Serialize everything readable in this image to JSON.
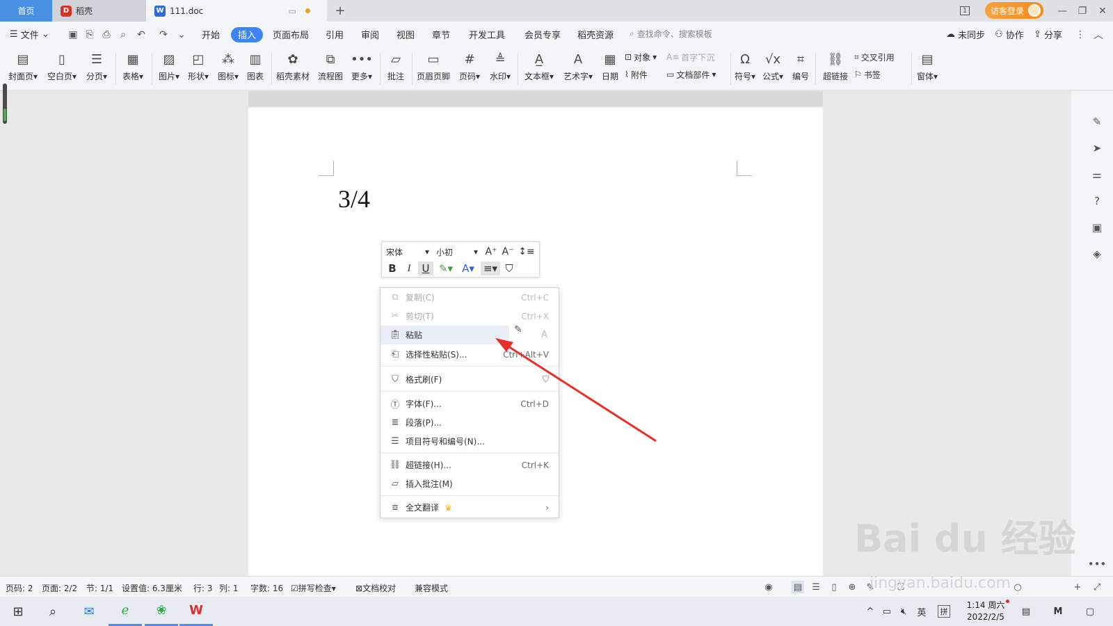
{
  "tabs": {
    "home": "首页",
    "daoke": "稻壳",
    "doc": "111.doc",
    "add": "+"
  },
  "titlebar": {
    "visitor_login": "访客登录",
    "page_badge": "1"
  },
  "menu": {
    "file": "文件",
    "items": [
      "开始",
      "插入",
      "页面布局",
      "引用",
      "审阅",
      "视图",
      "章节",
      "开发工具",
      "会员专享",
      "稻壳资源"
    ],
    "active": "插入",
    "search_placeholder": "查找命令、搜索模板",
    "not_synced": "未同步",
    "collaborate": "协作",
    "share": "分享"
  },
  "ribbon": {
    "buttons": [
      {
        "label": "封面页",
        "icon": "cover-page-icon"
      },
      {
        "label": "空白页",
        "icon": "blank-page-icon"
      },
      {
        "label": "分页",
        "icon": "page-break-icon"
      },
      {
        "label": "表格",
        "icon": "table-icon"
      },
      {
        "label": "图片",
        "icon": "picture-icon"
      },
      {
        "label": "形状",
        "icon": "shape-icon"
      },
      {
        "label": "图标",
        "icon": "icons-icon"
      },
      {
        "label": "图表",
        "icon": "chart-icon"
      },
      {
        "label": "稻壳素材",
        "icon": "material-icon"
      },
      {
        "label": "流程图",
        "icon": "flowchart-icon"
      },
      {
        "label": "更多",
        "icon": "more-icon"
      },
      {
        "label": "批注",
        "icon": "comment-icon"
      },
      {
        "label": "页眉页脚",
        "icon": "header-footer-icon"
      },
      {
        "label": "页码",
        "icon": "page-number-icon"
      },
      {
        "label": "水印",
        "icon": "watermark-icon"
      },
      {
        "label": "文本框",
        "icon": "textbox-icon"
      },
      {
        "label": "艺术字",
        "icon": "wordart-icon"
      },
      {
        "label": "日期",
        "icon": "date-icon"
      },
      {
        "label": "符号",
        "icon": "symbol-icon"
      },
      {
        "label": "公式",
        "icon": "formula-icon"
      },
      {
        "label": "编号",
        "icon": "numbering-icon"
      },
      {
        "label": "超链接",
        "icon": "hyperlink-icon"
      },
      {
        "label": "窗体",
        "icon": "form-icon"
      }
    ],
    "small": {
      "object": "对象",
      "dropcap": "首字下沉",
      "attachment": "附件",
      "doc_parts": "文档部件",
      "cross_ref": "交叉引用",
      "bookmark": "书签"
    }
  },
  "document": {
    "text": "3/4"
  },
  "mini_toolbar": {
    "font": "宋体",
    "size": "小初",
    "bold": "B",
    "italic": "I",
    "underline": "U"
  },
  "context_menu": {
    "items": [
      {
        "label": "复制(C)",
        "shortcut": "Ctrl+C",
        "disabled": true
      },
      {
        "label": "剪切(T)",
        "shortcut": "Ctrl+X",
        "disabled": true
      },
      {
        "label": "粘贴",
        "shortcut": "",
        "disabled": false
      },
      {
        "label": "选择性粘贴(S)...",
        "shortcut": "Ctrl+Alt+V",
        "disabled": false
      },
      {
        "label": "格式刷(F)",
        "shortcut": "",
        "disabled": false
      },
      {
        "label": "字体(F)...",
        "shortcut": "Ctrl+D",
        "disabled": false
      },
      {
        "label": "段落(P)...",
        "shortcut": "",
        "disabled": false
      },
      {
        "label": "项目符号和编号(N)...",
        "shortcut": "",
        "disabled": false
      },
      {
        "label": "超链接(H)...",
        "shortcut": "Ctrl+K",
        "disabled": false
      },
      {
        "label": "插入批注(M)",
        "shortcut": "",
        "disabled": false
      },
      {
        "label": "全文翻译",
        "shortcut": "›",
        "disabled": false
      }
    ]
  },
  "statusbar": {
    "page_no": "页码: 2",
    "pages": "页面: 2/2",
    "section": "节: 1/1",
    "setting": "设置值: 6.3厘米",
    "row": "行: 3",
    "col": "列: 1",
    "words": "字数: 16",
    "spell": "拼写检查",
    "proof": "文档校对",
    "compat": "兼容模式"
  },
  "taskbar": {
    "time": "1:14 周六",
    "date": "2022/2/5",
    "lang": "英",
    "ime": "拼"
  },
  "watermark": {
    "brand": "Bai du 经验",
    "url": "jingyan.baidu.com"
  },
  "colors": {
    "accent": "#3d85f5",
    "arrow": "#e8302a",
    "visitor": "#f48a1c"
  }
}
